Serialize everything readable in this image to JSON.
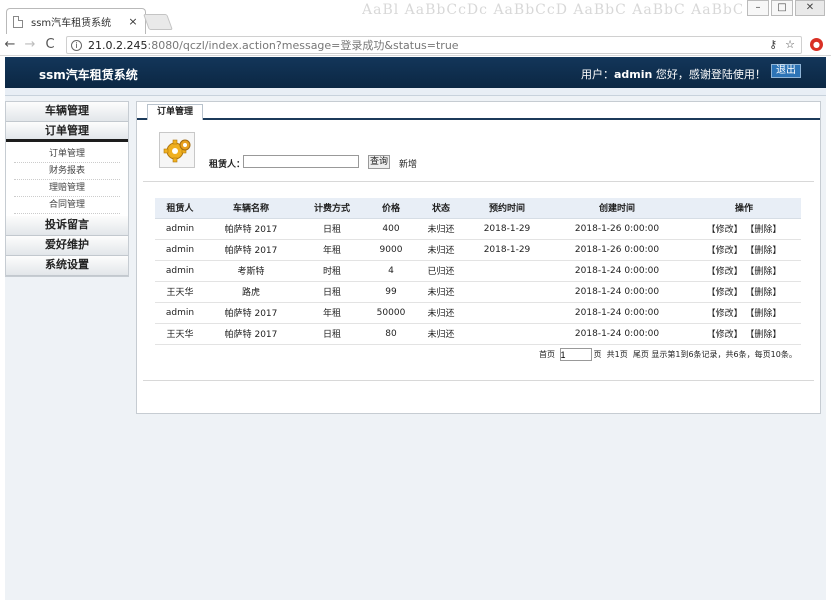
{
  "browser": {
    "tab_title": "ssm汽车租赁系统",
    "tab_close": "×",
    "bg_text": "AaBl AaBbCcDc AaBbCcD AaBbC AaBbC AaBbC AaBbC AaBbC AaBbC",
    "nav_back": "←",
    "nav_forward": "→",
    "nav_reload": "C",
    "url_host": "21.0.2.245",
    "url_path": ":8080/qczl/index.action?message=登录成功&status=true",
    "key_icon": "⚷",
    "star_icon": "☆",
    "win_min": "–",
    "win_max": "□",
    "win_close": "✕"
  },
  "header": {
    "title": "ssm汽车租赁系统",
    "user_prefix": "用户：",
    "username": "admin",
    "greeting": " 您好，感谢登陆使用！",
    "logout": "退出"
  },
  "sidebar": {
    "sections": [
      {
        "label": "车辆管理"
      },
      {
        "label": "订单管理"
      },
      {
        "label": "投诉留言"
      },
      {
        "label": "爱好维护"
      },
      {
        "label": "系统设置"
      }
    ],
    "sub_items": [
      {
        "label": "订单管理"
      },
      {
        "label": "财务报表"
      },
      {
        "label": "理赔管理"
      },
      {
        "label": "合同管理"
      }
    ]
  },
  "main": {
    "tab_label": "订单管理",
    "search_label": "租赁人：",
    "search_value": "",
    "search_button": "查询",
    "add_link": "新增"
  },
  "table": {
    "headers": [
      "租赁人",
      "车辆名称",
      "计费方式",
      "价格",
      "状态",
      "预约时间",
      "创建时间",
      "操作"
    ],
    "rows": [
      [
        "admin",
        "帕萨特 2017",
        "日租",
        "400",
        "未归还",
        "2018-1-29",
        "2018-1-26 0:00:00",
        "【修改】 【删除】"
      ],
      [
        "admin",
        "帕萨特 2017",
        "年租",
        "9000",
        "未归还",
        "2018-1-29",
        "2018-1-26 0:00:00",
        "【修改】 【删除】"
      ],
      [
        "admin",
        "考斯特",
        "时租",
        "4",
        "已归还",
        "",
        "2018-1-24 0:00:00",
        "【修改】 【删除】"
      ],
      [
        "王天华",
        "路虎",
        "日租",
        "99",
        "未归还",
        "",
        "2018-1-24 0:00:00",
        "【修改】 【删除】"
      ],
      [
        "admin",
        "帕萨特 2017",
        "年租",
        "50000",
        "未归还",
        "",
        "2018-1-24 0:00:00",
        "【修改】 【删除】"
      ],
      [
        "王天华",
        "帕萨特 2017",
        "日租",
        "80",
        "未归还",
        "",
        "2018-1-24 0:00:00",
        "【修改】 【删除】"
      ]
    ]
  },
  "pager": {
    "first_label": "首页",
    "page_value": "1",
    "page_suffix": "页",
    "total_pages": "共1页",
    "last_label": "尾页",
    "summary": "显示第1到6条记录，共6条，每页10条。"
  }
}
